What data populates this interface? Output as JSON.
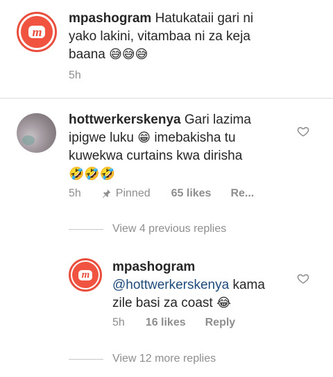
{
  "caption": {
    "username": "mpashogram",
    "text_line1": "Hatukataii gari ni",
    "text_line2": "yako lakini, vitambaa ni za keja",
    "text_line3": "baana",
    "emojis": "😅😅😅",
    "time": "5h",
    "avatar_badge": "m"
  },
  "comment": {
    "username": "hottwerkerskenya",
    "text_line1": "Gari lazima",
    "text_line2a": "ipigwe luku",
    "emoji_mid": "😁",
    "text_line2b": "imebakisha tu",
    "text_line3": "kuwekwa curtains kwa dirisha",
    "emojis_end": "🤣🤣🤣",
    "time": "5h",
    "pinned_label": "Pinned",
    "likes": "65 likes",
    "reply_label": "Re..."
  },
  "view_previous": "View 4 previous replies",
  "reply": {
    "username": "mpashogram",
    "mention": "@hottwerkerskenya",
    "text_a": "kama",
    "text_line2": "zile basi za coast",
    "emoji": "😂",
    "time": "5h",
    "likes": "16 likes",
    "reply_label": "Reply",
    "avatar_badge": "m"
  },
  "view_more": "View 12 more replies",
  "colors": {
    "brand": "#e94d3c",
    "meta_gray": "#8e8e8e",
    "mention_blue": "#1f4a7c"
  }
}
